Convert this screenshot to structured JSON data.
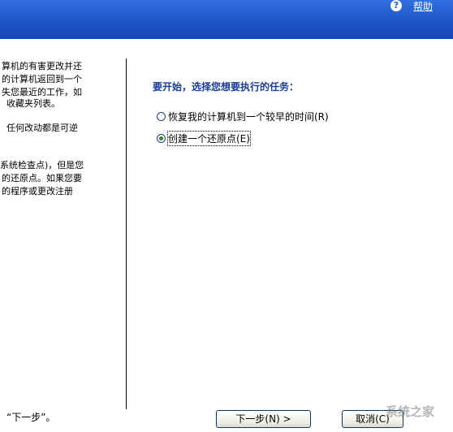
{
  "header": {
    "help_icon_glyph": "?",
    "help_label": "帮助"
  },
  "sidebar": {
    "lines": [
      "算机的有害更改并还",
      "的计算机返回到一个",
      "失您最近的工作，如",
      "收藏夹列表。",
      "任何改动都是可逆",
      "系统检查点)，但是您",
      "的还原点。如果您要",
      "的程序或更改注册"
    ],
    "footer_text": "“下一步”。"
  },
  "main": {
    "title": "要开始，选择您想要执行的任务：",
    "options": [
      {
        "label": "恢复我的计算机到一个较早的时间(R)",
        "selected": false
      },
      {
        "label": "创建一个还原点(E)",
        "selected": true
      }
    ]
  },
  "buttons": {
    "next_label": "下一步(N) >",
    "cancel_label": "取消(C)"
  },
  "watermark": "系统之家",
  "colors": {
    "header_blue": "#1f56c8",
    "title_blue": "#1a3c9a",
    "radio_dot": "#2c8a2c"
  }
}
